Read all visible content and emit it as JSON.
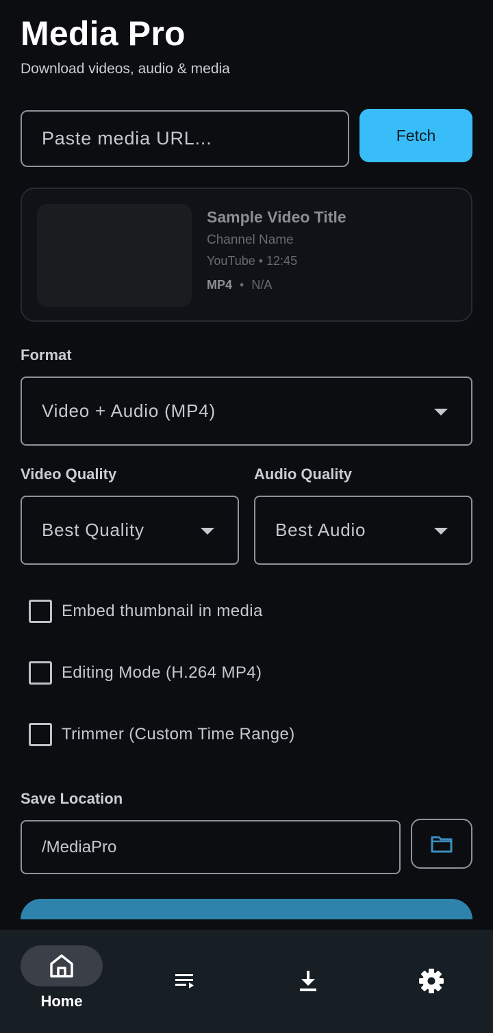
{
  "header": {
    "title": "Media Pro",
    "subtitle": "Download videos, audio & media"
  },
  "url_bar": {
    "placeholder": "Paste media URL...",
    "fetch_label": "Fetch"
  },
  "media_card": {
    "title": "Sample Video Title",
    "channel": "Channel Name",
    "meta": "YouTube • 12:45",
    "format": "MP4",
    "separator": "•",
    "size": "N/A"
  },
  "format": {
    "label": "Format",
    "selected": "Video + Audio (MP4)"
  },
  "video_quality": {
    "label": "Video Quality",
    "selected": "Best Quality"
  },
  "audio_quality": {
    "label": "Audio Quality",
    "selected": "Best Audio"
  },
  "options": [
    {
      "label": "Embed thumbnail in media",
      "checked": false
    },
    {
      "label": "Editing Mode (H.264 MP4)",
      "checked": false
    },
    {
      "label": "Trimmer (Custom Time Range)",
      "checked": false
    }
  ],
  "save_location": {
    "label": "Save Location",
    "value": "/MediaPro"
  },
  "bottom_nav": {
    "items": [
      {
        "label": "Home",
        "icon": "home-icon",
        "active": true
      },
      {
        "label": "",
        "icon": "queue-list-icon",
        "active": false
      },
      {
        "label": "",
        "icon": "download-icon",
        "active": false
      },
      {
        "label": "",
        "icon": "gear-icon",
        "active": false
      }
    ]
  },
  "colors": {
    "background": "#0b0d11",
    "accent": "#38bdf8",
    "download_bar": "#2d83ab",
    "nav_background": "#171e24",
    "folder_icon": "#3b8ec0"
  }
}
